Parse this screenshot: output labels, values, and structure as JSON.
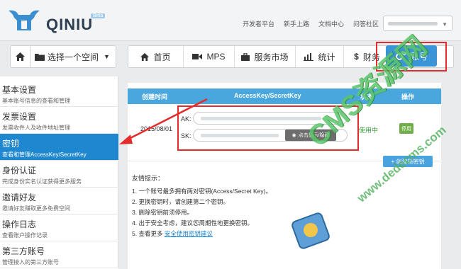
{
  "brand": {
    "name": "QINIU",
    "badge": "Beta"
  },
  "top_links": [
    "开发者平台",
    "新手上路",
    "文档中心",
    "问答社区"
  ],
  "space_selector": {
    "label": "选择一个空间"
  },
  "main_nav": [
    {
      "label": "首页",
      "icon": "home-icon"
    },
    {
      "label": "MPS",
      "icon": "video-icon"
    },
    {
      "label": "服务市场",
      "icon": "briefcase-icon"
    },
    {
      "label": "统计",
      "icon": "bar-chart-icon"
    },
    {
      "label": "财务",
      "icon": "dollar-icon"
    }
  ],
  "account_tab": {
    "label": "账号",
    "icon": "gears-icon"
  },
  "sidebar": [
    {
      "title": "基本设置",
      "desc": "基本账号信息的查看和管理",
      "active": false
    },
    {
      "title": "发票设置",
      "desc": "发票收件人及收件地址管理",
      "active": false
    },
    {
      "title": "密钥",
      "desc": "查看和管理AccessKey/SecretKey",
      "active": true
    },
    {
      "title": "身份认证",
      "desc": "完成身份实名认证获得更多服务",
      "active": false
    },
    {
      "title": "邀请好友",
      "desc": "邀请好友赚取更多免费空间",
      "active": false
    },
    {
      "title": "操作日志",
      "desc": "查看账户操作记录",
      "active": false
    },
    {
      "title": "第三方账号",
      "desc": "管理接入的第三方账号",
      "active": false
    }
  ],
  "table": {
    "headers": [
      "创建时间",
      "AccessKey/SecretKey",
      "状态",
      "操作"
    ],
    "row": {
      "date": "2015/08/01",
      "ak_label": "AK:",
      "sk_label": "SK:",
      "reveal_label": "点击显示/隐藏",
      "status": "使用中",
      "action": "停用"
    },
    "create_label": "+ 创建新密钥"
  },
  "tips": {
    "title": "友情提示：",
    "items": [
      "1. 一个账号最多拥有两对密钥(Access/Secret Key)。",
      "2. 更换密钥时，请创建第二个密钥。",
      "3. 删除密钥前须停用。",
      "4. 出于安全考虑，建议您周期性地更换密钥。",
      "5. 查看更多"
    ],
    "link": "安全使用密钥建议"
  },
  "watermark": {
    "text": "CMS资源网",
    "url": "www.dedecms.com"
  },
  "colors": {
    "accent": "#1e87cf",
    "highlight": "#e52c2c",
    "status": "#3a9f3a"
  }
}
